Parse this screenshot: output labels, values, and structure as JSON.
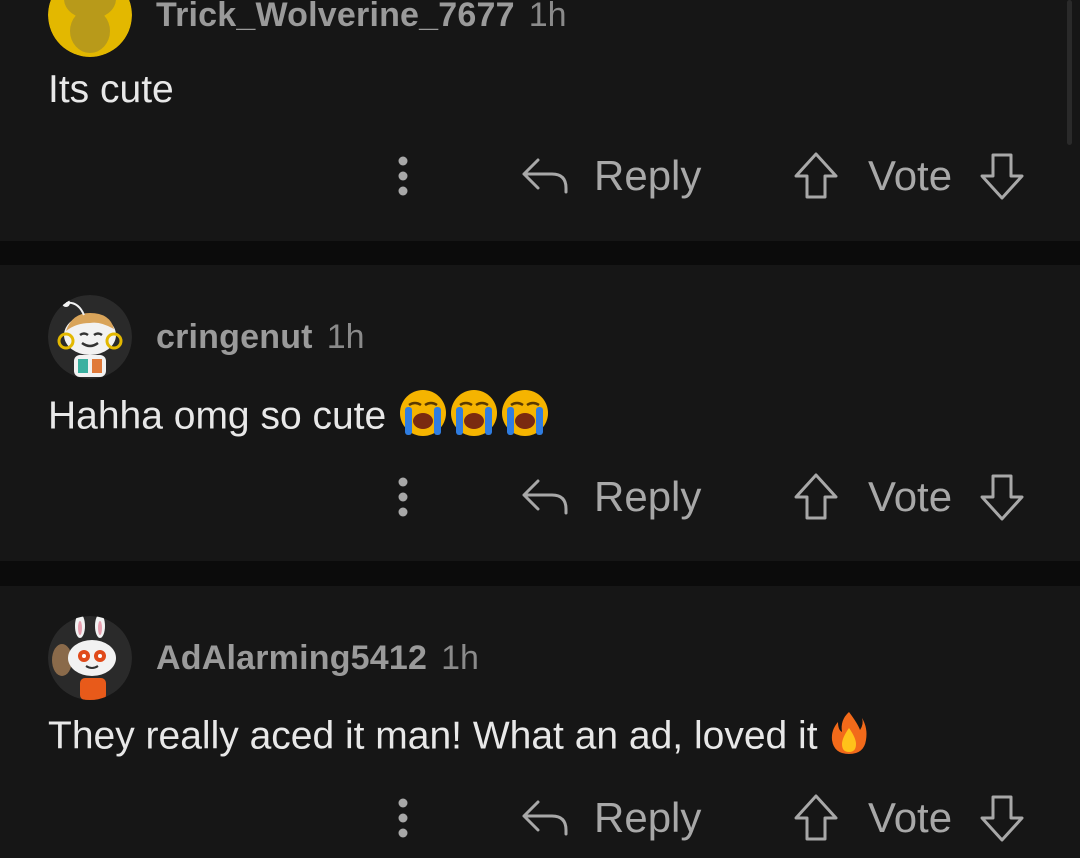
{
  "comments": [
    {
      "username": "Trick_Wolverine_7677",
      "time": "1h",
      "text": "Its cute",
      "emoji": "",
      "avatar": "yellow-snoo-avatar",
      "actions": {
        "reply_label": "Reply",
        "vote_label": "Vote"
      }
    },
    {
      "username": "cringenut",
      "time": "1h",
      "text": "Hahha omg so cute",
      "emoji": "loudly-crying-face x3",
      "avatar": "snoo-with-gold-earrings-avatar",
      "actions": {
        "reply_label": "Reply",
        "vote_label": "Vote"
      }
    },
    {
      "username": "AdAlarming5412",
      "time": "1h",
      "text": "They really aced it man! What an ad, loved it",
      "emoji": "fire",
      "avatar": "snoo-bunny-ears-avatar",
      "actions": {
        "reply_label": "Reply",
        "vote_label": "Vote"
      }
    }
  ],
  "colors": {
    "background": "#0b0b0b",
    "card": "#161616",
    "username": "#9a9a9a",
    "body_text": "#e8e8e8",
    "action_text": "#a8a8a8"
  }
}
